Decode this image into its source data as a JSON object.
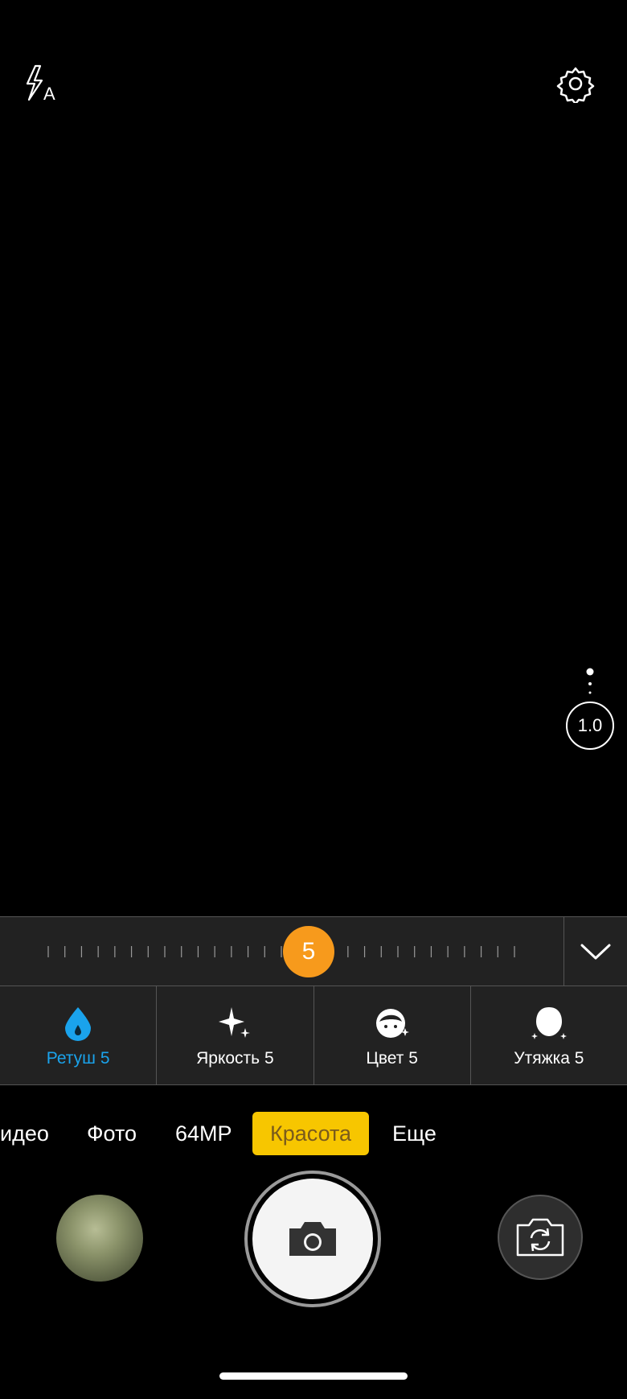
{
  "top_bar": {
    "flash_icon": "flash-auto-icon",
    "settings_icon": "gear-icon"
  },
  "zoom": {
    "value": "1.0",
    "more_icon": "vertical-dots-icon"
  },
  "beauty_slider": {
    "value": "5",
    "level_fraction": 0.5,
    "collapse_icon": "chevron-down-icon"
  },
  "beauty_options": [
    {
      "label": "Ретуш 5",
      "icon": "water-drop-icon",
      "active": true
    },
    {
      "label": "Яркость 5",
      "icon": "sparkle-icon",
      "active": false
    },
    {
      "label": "Цвет 5",
      "icon": "face-color-icon",
      "active": false
    },
    {
      "label": "Утяжка 5",
      "icon": "face-slim-icon",
      "active": false
    }
  ],
  "modes": [
    {
      "label": "идео",
      "active": false
    },
    {
      "label": "Фото",
      "active": false
    },
    {
      "label": "64MP",
      "active": false
    },
    {
      "label": "Красота",
      "active": true
    },
    {
      "label": "Еще",
      "active": false
    }
  ],
  "bottom_controls": {
    "gallery": "gallery-thumbnail",
    "shutter_icon": "camera-icon",
    "switch_icon": "switch-camera-icon"
  },
  "colors": {
    "accent_slider": "#f79a1c",
    "active_option": "#1aa3ec",
    "active_mode_bg": "#f7c600",
    "active_mode_text": "#7a5b1c"
  }
}
